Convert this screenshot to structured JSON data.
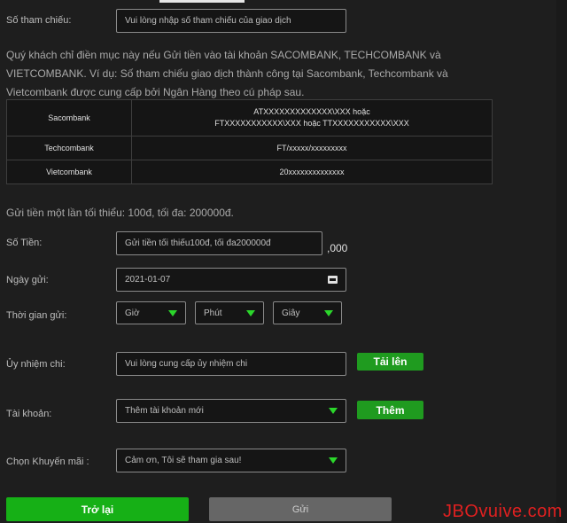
{
  "reference": {
    "label": "Số tham chiếu:",
    "placeholder": "Vui lòng nhập số tham chiếu của giao dịch"
  },
  "reference_note": {
    "line1": "Quý khách chỉ điền mục này nếu Gửi tiền vào tài khoản SACOMBANK, TECHCOMBANK và",
    "line2": "VIETCOMBANK. Ví dụ: Số tham chiếu giao dịch thành công tại Sacombank, Techcombank và",
    "line3": "Vietcombank được cung cấp bởi Ngân Hàng theo cú pháp sau."
  },
  "reference_table": [
    {
      "bank": "Sacombank",
      "format_line1": "ATXXXXXXXXXXXXX\\XXX hoặc",
      "format_line2": "FTXXXXXXXXXXX\\XXX hoặc TTXXXXXXXXXXX\\XXX"
    },
    {
      "bank": "Techcombank",
      "format_line1": "FT/xxxxx/xxxxxxxxx",
      "format_line2": ""
    },
    {
      "bank": "Vietcombank",
      "format_line1": "20xxxxxxxxxxxxxx",
      "format_line2": ""
    }
  ],
  "limit_note": "Gửi tiền một lần tối thiểu: 100đ, tối đa: 200000đ.",
  "amount": {
    "label": "Số Tiền:",
    "placeholder": "Gửi tiền tối thiểu100đ, tối đa200000đ",
    "suffix": ",000"
  },
  "date": {
    "label": "Ngày gửi:",
    "value": "2021-01-07",
    "icon": "calendar-icon"
  },
  "time": {
    "label": "Thời gian gửi:",
    "hour": "Giờ",
    "minute": "Phút",
    "second": "Giây"
  },
  "authorization": {
    "label": "Ủy nhiệm chi:",
    "placeholder": "Vui lòng cung cấp ủy nhiệm chi",
    "upload_button": "Tải lên"
  },
  "account": {
    "label": "Tài khoản:",
    "value": "Thêm tài khoản mới",
    "add_button": "Thêm"
  },
  "promotion": {
    "label": "Chọn Khuyến mãi :",
    "value": "Cảm ơn, Tôi sẽ tham gia sau!"
  },
  "actions": {
    "back": "Trở lại",
    "submit": "Gửi"
  },
  "watermark": "JBOvuive.com",
  "colors": {
    "accent_green": "#1f9b1f",
    "dropdown_arrow": "#2bd62b",
    "watermark_red": "#e02020"
  }
}
